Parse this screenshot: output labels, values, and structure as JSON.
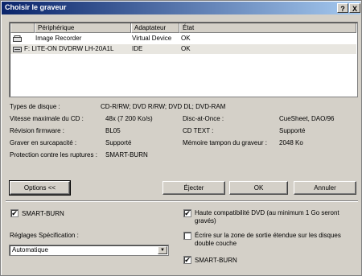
{
  "window": {
    "title": "Choisir le graveur",
    "help_button": "?",
    "close_button": "X"
  },
  "device_list": {
    "columns": [
      "Périphérique",
      "Adaptateur",
      "État"
    ],
    "rows": [
      {
        "device": "Image Recorder",
        "adapter": "Virtual Device",
        "state": "OK",
        "selected": false
      },
      {
        "device": "F:  LITE-ON DVDRW LH-20A1L",
        "adapter": "IDE",
        "state": "OK",
        "selected": true
      }
    ]
  },
  "info": {
    "disc_types_label": "Types de disque :",
    "disc_types_value": "CD-R/RW; DVD R/RW; DVD DL; DVD-RAM",
    "max_speed_label": "Vitesse maximale du CD :",
    "max_speed_value": "48x (7 200 Ko/s)",
    "firmware_label": "Révision firmware :",
    "firmware_value": "BL05",
    "overburn_label": "Graver en surcapacité :",
    "overburn_value": "Supporté",
    "protection_label": "Protection contre les ruptures :",
    "protection_value": "SMART-BURN",
    "dao_label": "Disc-at-Once :",
    "dao_value": "CueSheet, DAO/96",
    "cdtext_label": "CD TEXT :",
    "cdtext_value": "Supporté",
    "buffer_label": "Mémoire tampon du graveur :",
    "buffer_value": "2048 Ko"
  },
  "buttons": {
    "options": "Options <<",
    "eject": "Éjecter",
    "ok": "OK",
    "cancel": "Annuler"
  },
  "options": {
    "smartburn_left": {
      "label": "SMART-BURN",
      "checked": true
    },
    "spec_label": "Réglages Spécification :",
    "spec_value": "Automatique",
    "dvd_compat": {
      "label_line1": "Haute compatibilité DVD (au minimum 1 Go seront",
      "label_line2": "gravés)",
      "checked": true
    },
    "extended_leadout": {
      "label_line1": "Écrire sur la zone de sortie étendue sur les disques",
      "label_line2": "double couche",
      "checked": false
    },
    "smartburn_right": {
      "label": "SMART-BURN",
      "checked": true
    }
  }
}
